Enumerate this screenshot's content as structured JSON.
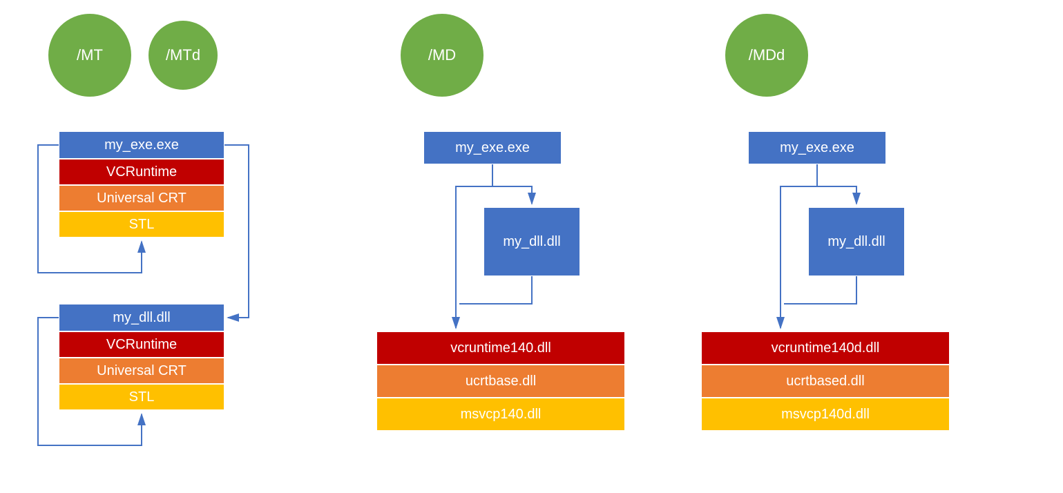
{
  "circles": {
    "mt": "/MT",
    "mtd": "/MTd",
    "md": "/MD",
    "mdd": "/MDd"
  },
  "col1": {
    "stack1": {
      "row0": "my_exe.exe",
      "row1": "VCRuntime",
      "row2": "Universal CRT",
      "row3": "STL"
    },
    "stack2": {
      "row0": "my_dll.dll",
      "row1": "VCRuntime",
      "row2": "Universal CRT",
      "row3": "STL"
    }
  },
  "col2": {
    "exe": "my_exe.exe",
    "dll": "my_dll.dll",
    "row0": "vcruntime140.dll",
    "row1": "ucrtbase.dll",
    "row2": "msvcp140.dll"
  },
  "col3": {
    "exe": "my_exe.exe",
    "dll": "my_dll.dll",
    "row0": "vcruntime140d.dll",
    "row1": "ucrtbased.dll",
    "row2": "msvcp140d.dll"
  }
}
